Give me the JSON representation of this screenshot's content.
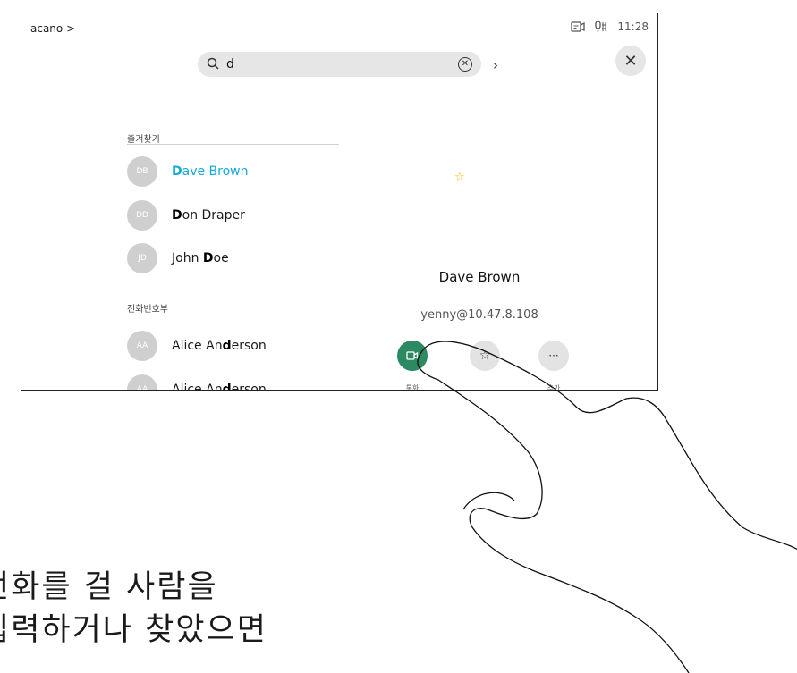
{
  "header": {
    "breadcrumb": "acano >",
    "time": "11:28"
  },
  "search": {
    "query": "d"
  },
  "favorites": {
    "label": "즐겨찾기",
    "contacts": [
      {
        "initials": "DB",
        "match": "D",
        "rest": "ave Brown",
        "selected": true
      },
      {
        "initials": "DD",
        "match": "D",
        "rest": "on Draper",
        "selected": false
      },
      {
        "initials": "JD",
        "prefix": "John ",
        "match": "D",
        "rest": "oe",
        "selected": false
      }
    ]
  },
  "directory": {
    "label": "전화번호부",
    "contacts": [
      {
        "initials": "AA",
        "prefix": "Alice An",
        "match": "d",
        "rest": "erson"
      },
      {
        "initials": "AA",
        "prefix": "Alice An",
        "match": "d",
        "rest": "erson"
      }
    ]
  },
  "details": {
    "name": "Dave Brown",
    "uri": "yenny@10.47.8.108",
    "more_glyph": "···",
    "call_label": "통화",
    "more_label": "추가"
  },
  "caption": {
    "line1": "전화를 걸 사람을",
    "line2": "입력하거나 찾았으면"
  },
  "colors": {
    "accent": "#14a9d8",
    "call_button": "#2c8a63",
    "star": "#e8b800"
  },
  "icons": [
    "camera-icon",
    "microphone-icon",
    "search-icon",
    "clear-icon",
    "chevron-right-icon",
    "close-icon",
    "star-icon",
    "video-call-icon",
    "more-icon",
    "hand-pointer-illustration"
  ]
}
